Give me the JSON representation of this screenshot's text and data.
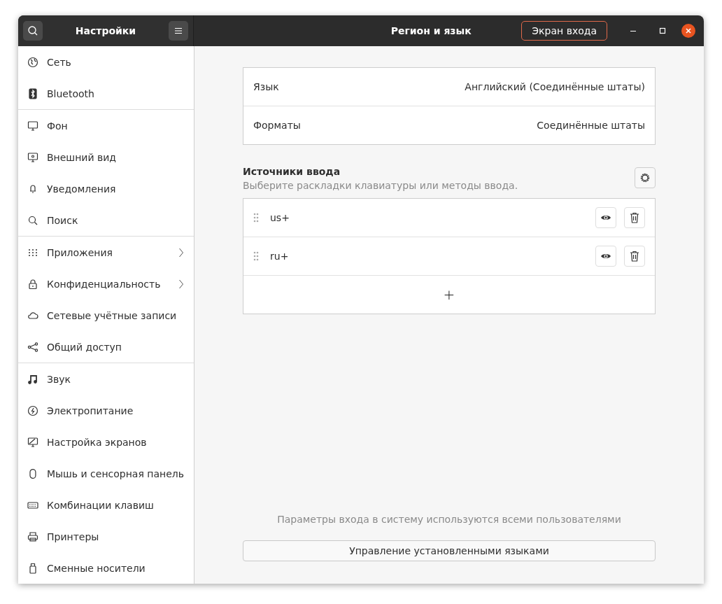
{
  "window": {
    "title": "Регион и язык",
    "sidebar_title": "Настройки",
    "login_screen_button": {
      "label": "Экран входа",
      "selected": false
    }
  },
  "sidebar": {
    "groups": [
      [
        {
          "label": "Сеть",
          "submenu": false,
          "selected": false
        },
        {
          "label": "Bluetooth",
          "submenu": false,
          "selected": false
        }
      ],
      [
        {
          "label": "Фон",
          "submenu": false,
          "selected": false
        },
        {
          "label": "Внешний вид",
          "submenu": false,
          "selected": false
        },
        {
          "label": "Уведомления",
          "submenu": false,
          "selected": false
        },
        {
          "label": "Поиск",
          "submenu": false,
          "selected": false
        }
      ],
      [
        {
          "label": "Приложения",
          "submenu": true,
          "selected": false
        },
        {
          "label": "Конфиденциальность",
          "submenu": true,
          "selected": false
        },
        {
          "label": "Сетевые учётные записи",
          "submenu": false,
          "selected": false
        },
        {
          "label": "Общий доступ",
          "submenu": false,
          "selected": false
        }
      ],
      [
        {
          "label": "Звук",
          "submenu": false,
          "selected": false
        },
        {
          "label": "Электропитание",
          "submenu": false,
          "selected": false
        },
        {
          "label": "Настройка экранов",
          "submenu": false,
          "selected": false
        },
        {
          "label": "Мышь и сенсорная панель",
          "submenu": false,
          "selected": false
        },
        {
          "label": "Комбинации клавиш",
          "submenu": false,
          "selected": false
        },
        {
          "label": "Принтеры",
          "submenu": false,
          "selected": false
        },
        {
          "label": "Сменные носители",
          "submenu": false,
          "selected": false
        }
      ]
    ]
  },
  "settings": [
    {
      "label": "Язык",
      "value": "Английский (Соединённые штаты)"
    },
    {
      "label": "Форматы",
      "value": "Соединённые штаты"
    }
  ],
  "input_sources": {
    "title": "Источники ввода",
    "subtitle": "Выберите раскладки клавиатуры или методы ввода.",
    "items": [
      {
        "label": "us+"
      },
      {
        "label": "ru+"
      }
    ],
    "add_label": "+"
  },
  "footer": {
    "note": "Параметры входа в систему используются всеми пользователями",
    "button": "Управление установленными языками"
  }
}
